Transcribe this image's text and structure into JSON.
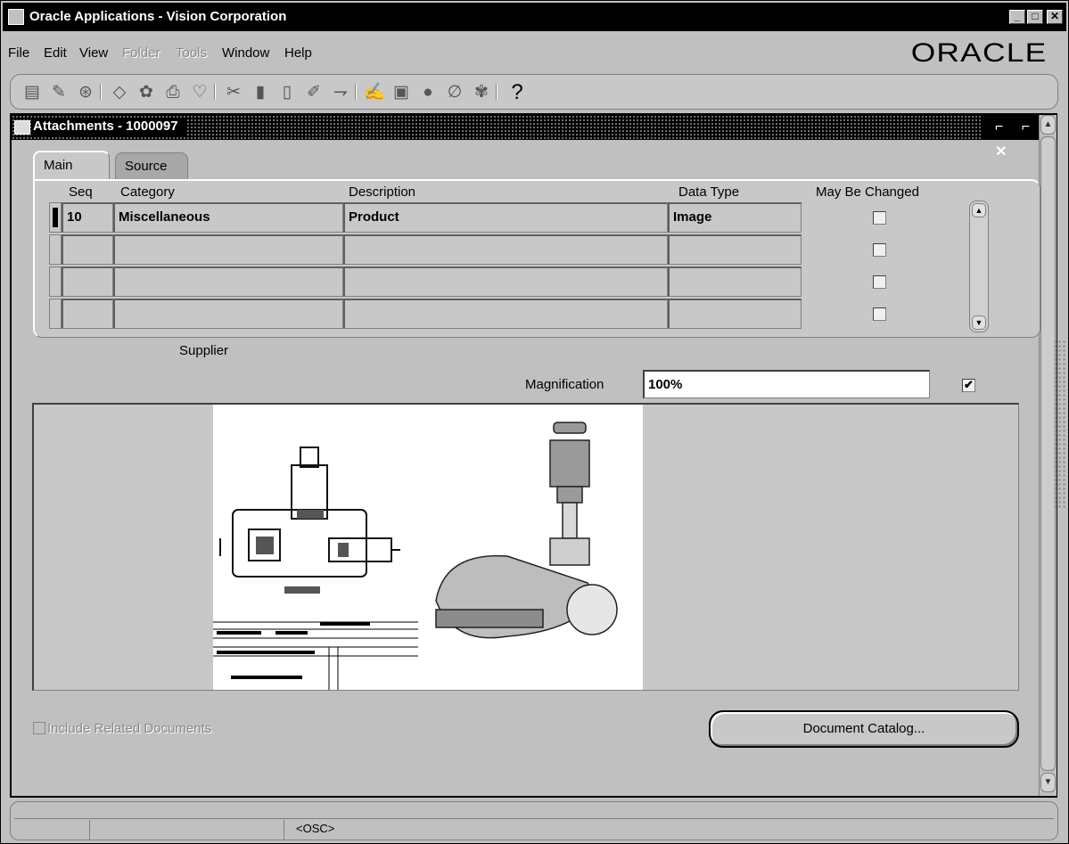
{
  "app": {
    "title": "Oracle Applications - Vision Corporation",
    "logo": "ORACLE",
    "window_buttons": [
      "_",
      "□",
      "✕"
    ]
  },
  "menu": [
    {
      "label": "File",
      "enabled": true
    },
    {
      "label": "Edit",
      "enabled": true
    },
    {
      "label": "View",
      "enabled": true
    },
    {
      "label": "Folder",
      "enabled": false
    },
    {
      "label": "Tools",
      "enabled": false
    },
    {
      "label": "Window",
      "enabled": true
    },
    {
      "label": "Help",
      "enabled": true
    }
  ],
  "toolbar": {
    "icons": [
      "new-icon",
      "find-icon",
      "navigate-icon",
      "save-icon",
      "next-step-icon",
      "print-icon",
      "close-form-icon",
      "cut-icon",
      "copy-icon",
      "paste-icon",
      "clear-record-icon",
      "delete-record-icon",
      "edit-field-icon",
      "zoom-icon",
      "translations-icon",
      "attachments-icon",
      "folder-tools-icon",
      "help-icon"
    ],
    "help_glyph": "?"
  },
  "form": {
    "title": "Attachments - 1000097",
    "title_buttons": "⌐ ⌐ ✕",
    "tabs": [
      {
        "label": "Main",
        "active": true
      },
      {
        "label": "Source",
        "active": false
      }
    ],
    "columns": {
      "seq": "Seq",
      "category": "Category",
      "description": "Description",
      "data_type": "Data Type",
      "may_be_changed": "May Be Changed"
    },
    "rows": [
      {
        "seq": "10",
        "category": "Miscellaneous",
        "description": "Product",
        "data_type": "Image",
        "may_be_changed": false,
        "current": true
      },
      {
        "seq": "",
        "category": "",
        "description": "",
        "data_type": "",
        "may_be_changed": false,
        "current": false
      },
      {
        "seq": "",
        "category": "",
        "description": "",
        "data_type": "",
        "may_be_changed": false,
        "current": false
      },
      {
        "seq": "",
        "category": "",
        "description": "",
        "data_type": "",
        "may_be_changed": false,
        "current": false
      }
    ],
    "supplier_label": "Supplier",
    "magnification_label": "Magnification",
    "magnification_value": "100%",
    "magnification_checked": true,
    "include_related_label": "Include Related Documents",
    "include_related_checked": false,
    "document_catalog_label": "Document Catalog..."
  },
  "status": {
    "osc": "<OSC>"
  }
}
